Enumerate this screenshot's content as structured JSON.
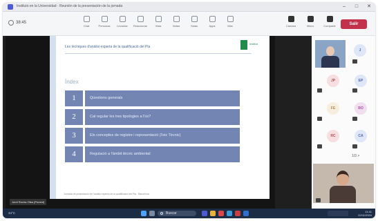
{
  "window": {
    "title": "Instituto en la Universidad · Reunión de la presentación de la jornada",
    "controls": [
      "–",
      "□",
      "✕"
    ]
  },
  "meeting": {
    "timer": "38:45",
    "leave_label": "Salir",
    "toolbar": [
      {
        "icon": "chat-icon",
        "label": "Chat"
      },
      {
        "icon": "people-icon",
        "label": "Personas"
      },
      {
        "icon": "raise-hand-icon",
        "label": "Levantar"
      },
      {
        "icon": "react-icon",
        "label": "Reaccionar"
      },
      {
        "icon": "view-icon",
        "label": "Vista"
      },
      {
        "icon": "notes-icon",
        "label": "Notas"
      },
      {
        "icon": "rooms-icon",
        "label": "Salas"
      },
      {
        "icon": "apps-icon",
        "label": "Apps"
      },
      {
        "icon": "more-icon",
        "label": "Más"
      },
      {
        "icon": "camera-icon",
        "label": "Cámara"
      },
      {
        "icon": "mic-icon",
        "label": "Micro"
      },
      {
        "icon": "share-icon",
        "label": "Compartir"
      }
    ]
  },
  "slide": {
    "header": "Les tècniques d'anàlisi experta de la qualificació del Pla",
    "logo_text": "Institut",
    "title": "Índex",
    "items": [
      {
        "num": "1",
        "label": "Qüestions generals"
      },
      {
        "num": "2",
        "label": "Cal regular les tres tipologies a l'ús?"
      },
      {
        "num": "3",
        "label": "Els conceptes de registre i representació (l'eix Tècnic)"
      },
      {
        "num": "4",
        "label": "Regulació a l'àmbit tècnic ambiental"
      }
    ],
    "footer": "Jornada de presentació de l'anàlisi experta de la qualificació del Pla · Barcelona"
  },
  "presenter_tag": "Jordi Rovira Ofsa (Ponent)",
  "participants": [
    {
      "initials": "J",
      "bg": "#dfe6f7",
      "fg": "#4c63b6"
    },
    {
      "initials": "JP",
      "bg": "#f7dfe1",
      "fg": "#b64c58"
    },
    {
      "initials": "EP",
      "bg": "#dfe6f7",
      "fg": "#4c63b6"
    },
    {
      "initials": "FE",
      "bg": "#f7eedd",
      "fg": "#b6884c"
    },
    {
      "initials": "RO",
      "bg": "#f1dff0",
      "fg": "#a04c9e"
    },
    {
      "initials": "RC",
      "bg": "#f7dfe1",
      "fg": "#b64c58"
    },
    {
      "initials": "CA",
      "bg": "#dfe6f7",
      "fg": "#4c63b6"
    }
  ],
  "pager": "1/3 >",
  "taskbar": {
    "start_text": "34°C",
    "search_label": "Buscar",
    "time": "11:41",
    "date": "22/11/2024"
  }
}
